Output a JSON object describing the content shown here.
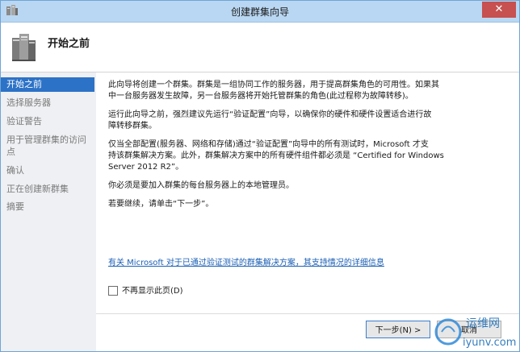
{
  "window": {
    "title": "创建群集向导",
    "close_glyph": "✕"
  },
  "header": {
    "title": "开始之前"
  },
  "sidebar": {
    "items": [
      {
        "label": "开始之前",
        "active": true
      },
      {
        "label": "选择服务器",
        "active": false
      },
      {
        "label": "验证警告",
        "active": false
      },
      {
        "label": "用于管理群集的访问",
        "label2": "点",
        "active": false
      },
      {
        "label": "确认",
        "active": false
      },
      {
        "label": "正在创建新群集",
        "active": false
      },
      {
        "label": "摘要",
        "active": false
      }
    ]
  },
  "content": {
    "p1_line1": "此向导将创建一个群集。群集是一组协同工作的服务器，用于提高群集角色的可用性。如果其",
    "p1_line2": "中一台服务器发生故障，另一台服务器将开始托管群集的角色(此过程称为故障转移)。",
    "p2_line1": "运行此向导之前，强烈建议先运行“验证配置”向导，以确保你的硬件和硬件设置适合进行故",
    "p2_line2": "障转移群集。",
    "p3_line1": "仅当全部配置(服务器、网络和存储)通过“验证配置”向导中的所有测试时，Microsoft 才支",
    "p3_line2": "持该群集解决方案。此外，群集解决方案中的所有硬件组件都必须是 “Certified for Windows",
    "p3_line3": "Server 2012 R2”。",
    "p4": "你必须是要加入群集的每台服务器上的本地管理员。",
    "p5": "若要继续，请单击“下一步”。",
    "link": "有关 Microsoft 对于已通过验证测试的群集解决方案，其支持情况的详细信息",
    "checkbox_label": "不再显示此页(D)",
    "checkbox_checked": false
  },
  "buttons": {
    "next": "下一步(N) >",
    "cancel": "取消"
  },
  "watermark": {
    "text_top": "运维网",
    "text_bottom": "iyunv.com"
  },
  "colors": {
    "titlebar": "#b9d7f2",
    "close": "#c75050",
    "sidebar_active": "#2c72c7",
    "link": "#1a5fb4"
  }
}
